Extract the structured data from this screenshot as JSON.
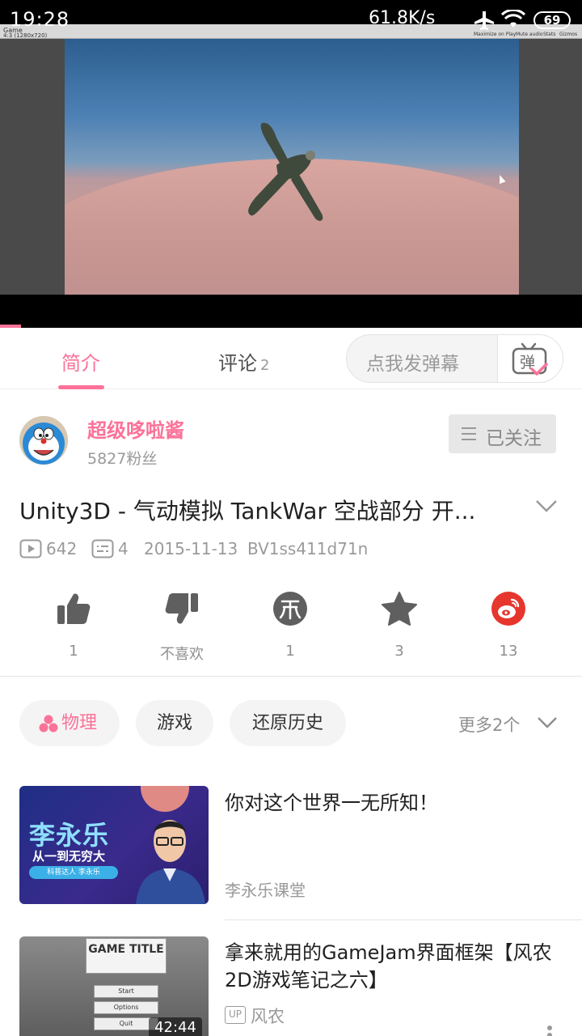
{
  "status_bar": {
    "time": "19:28",
    "speed": "61.8K/s",
    "battery": "69"
  },
  "player": {
    "editor_tab": "Game",
    "editor_resolution": "4:3 (1280x720)",
    "editor_buttons": [
      "Maximize on Play",
      "Mute audio",
      "Stats",
      "Gizmos"
    ],
    "progress_percent": 3.6
  },
  "tabs": {
    "intro": "简介",
    "comments": "评论",
    "comments_count": "2"
  },
  "danmaku": {
    "placeholder": "点我发弹幕",
    "button_char": "弹"
  },
  "uploader": {
    "name": "超级哆啦酱",
    "fans": "5827粉丝",
    "follow_label": "已关注"
  },
  "video": {
    "title": "Unity3D - 气动模拟 TankWar 空战部分 开...",
    "views": "642",
    "danmaku_count": "4",
    "date": "2015-11-13",
    "bvid": "BV1ss411d71n"
  },
  "actions": {
    "like": "1",
    "dislike": "不喜欢",
    "coin": "1",
    "favorite": "3",
    "share": "13"
  },
  "tags": {
    "items": [
      "物理",
      "游戏",
      "还原历史"
    ],
    "more": "更多2个"
  },
  "related": [
    {
      "title": "你对这个世界一无所知！",
      "author": "李永乐课堂",
      "thumb_big": "李永乐",
      "thumb_sub": "从一到无穷大",
      "thumb_small": "科普达人 李永乐"
    },
    {
      "title": "拿来就用的GameJam界面框架【风农2D游戏笔记之六】",
      "author": "风农",
      "up_badge": "UP",
      "duration": "42:44",
      "thumb_title": "GAME TITLE",
      "thumb_buttons": [
        "Start",
        "Options",
        "Quit"
      ]
    }
  ]
}
